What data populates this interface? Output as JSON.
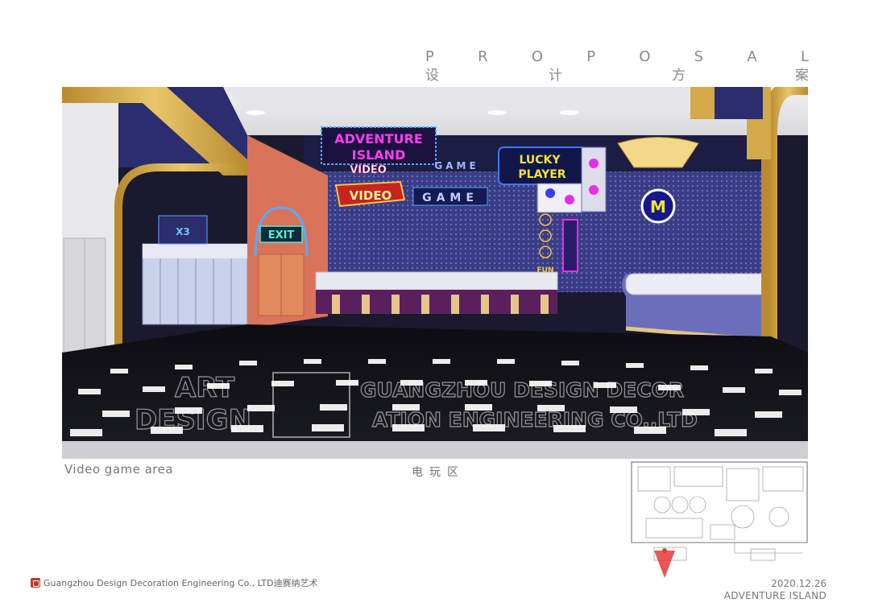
{
  "header": {
    "proposal_letters": [
      "P",
      "R",
      "O",
      "P",
      "O",
      "S",
      "A",
      "L"
    ],
    "proposal_cn": [
      "设",
      "计",
      "方",
      "案"
    ]
  },
  "render": {
    "signs": {
      "adventure": "ADVENTURE",
      "island": "ISLAND",
      "video_top": "VIDEO",
      "game_top": "GAME",
      "video": "VIDEO",
      "game": "GAME",
      "lucky": "LUCKY",
      "player": "PLAYER",
      "exit": "EXIT",
      "x3": "X3",
      "m": "M",
      "fun": "FUN"
    },
    "watermark": {
      "art": "ART",
      "design": "DESIGN",
      "company_line1": "GUANGZHOU DESIGN DECOR",
      "company_line2": "ATION ENGINEERING CO.,LTD"
    }
  },
  "caption": {
    "en": "Video game area",
    "cn": "电玩区"
  },
  "footer": {
    "company": "Guangzhou Design Decoration Engineering Co., LTD迪赛纳艺术",
    "date": "2020.12.26",
    "project": "ADVENTURE ISLAND"
  },
  "colors": {
    "navy_wall": "#2b2d6e",
    "gold_trim": "#d4a94a",
    "neon_magenta": "#e62ee6",
    "neon_yellow": "#f2e532",
    "neon_blue": "#3a7bff",
    "salmon_wall": "#d9735a"
  }
}
